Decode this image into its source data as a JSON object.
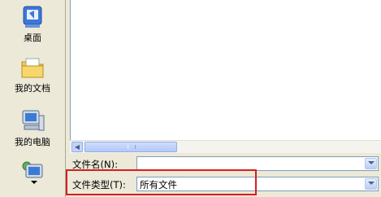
{
  "places": [
    {
      "label": "桌面",
      "icon": "desktop-icon"
    },
    {
      "label": "我的文档",
      "icon": "my-documents-icon"
    },
    {
      "label": "我的电脑",
      "icon": "my-computer-icon"
    },
    {
      "label": "",
      "icon": "network-places-icon"
    }
  ],
  "filename": {
    "label": "文件名(N):",
    "value": ""
  },
  "filetype": {
    "label": "文件类型(T):",
    "value": "所有文件"
  },
  "colors": {
    "highlight": "#d42020",
    "dialog_bg": "#ece9d8",
    "border": "#7f9db9"
  }
}
